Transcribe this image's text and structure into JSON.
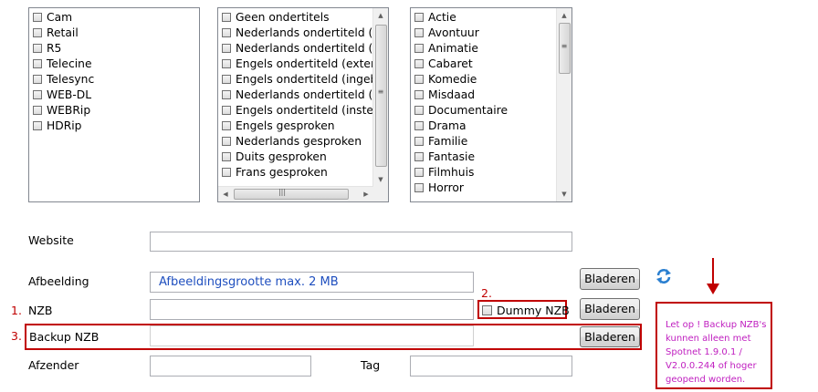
{
  "lists": {
    "format": [
      "Cam",
      "Retail",
      "R5",
      "Telecine",
      "Telesync",
      "WEB-DL",
      "WEBRip",
      "HDRip"
    ],
    "subtitles": [
      "Geen ondertitels",
      "Nederlands ondertiteld (ex",
      "Nederlands ondertiteld (in",
      "Engels ondertiteld (extern)",
      "Engels ondertiteld (ingeba",
      "Nederlands ondertiteld (in",
      "Engels ondertiteld (instelba",
      "Engels gesproken",
      "Nederlands gesproken",
      "Duits gesproken",
      "Frans gesproken"
    ],
    "genre": [
      "Actie",
      "Avontuur",
      "Animatie",
      "Cabaret",
      "Komedie",
      "Misdaad",
      "Documentaire",
      "Drama",
      "Familie",
      "Fantasie",
      "Filmhuis",
      "Horror"
    ]
  },
  "form": {
    "website_label": "Website",
    "website_value": "",
    "image_label": "Afbeelding",
    "image_hint": "Afbeeldingsgrootte max. 2 MB",
    "nzb_label": "NZB",
    "nzb_value": "",
    "dummy_nzb_label": "Dummy NZB",
    "backup_nzb_label": "Backup NZB",
    "backup_nzb_value": "",
    "sender_label": "Afzender",
    "sender_value": "",
    "tag_label": "Tag",
    "tag_value": "",
    "browse_label": "Bladeren"
  },
  "annotations": {
    "n1": "1.",
    "n2": "2.",
    "n3": "3.",
    "note": "Let op ! Backup NZB's kunnen alleen met Spotnet 1.9.0.1 / V2.0.0.244 of hoger geopend worden."
  },
  "colors": {
    "annotation_red": "#c00000",
    "note_magenta": "#c020c0",
    "hint_blue": "#1f4fbf",
    "refresh_blue": "#2a7fd0"
  },
  "icons": {
    "refresh": "refresh-icon",
    "arrow": "arrow-down-icon"
  }
}
